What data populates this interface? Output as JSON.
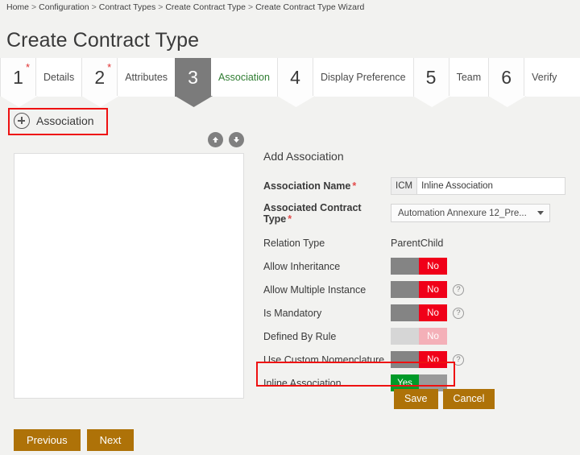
{
  "breadcrumb": {
    "items": [
      "Home",
      "Configuration",
      "Contract Types",
      "Create Contract Type",
      "Create Contract Type Wizard"
    ],
    "separator": ">"
  },
  "page": {
    "title": "Create Contract Type"
  },
  "wizard": {
    "steps": [
      {
        "number": "1",
        "label": "Details",
        "required": "*",
        "active": false
      },
      {
        "number": "2",
        "label": "Attributes",
        "required": "*",
        "active": false
      },
      {
        "number": "3",
        "label": "Association",
        "required": "",
        "active": true
      },
      {
        "number": "4",
        "label": "Display Preference",
        "required": "",
        "active": false
      },
      {
        "number": "5",
        "label": "Team",
        "required": "",
        "active": false
      },
      {
        "number": "6",
        "label": "Verify",
        "required": "",
        "active": false
      }
    ],
    "active_color": "#7b7b7b",
    "active_label_color": "#2f7d32"
  },
  "association_section": {
    "add_label": "Association",
    "add_icon": "plus-circle-icon",
    "move_up_icon": "arrow-up-icon",
    "move_down_icon": "arrow-down-icon",
    "list_items": []
  },
  "form": {
    "title": "Add Association",
    "association_name": {
      "label": "Association Name",
      "required": "*",
      "prefix": "ICM",
      "value": "Inline Association",
      "placeholder": ""
    },
    "associated_contract_type": {
      "label": "Associated Contract Type",
      "required": "*",
      "selected": "Automation Annexure 12_Pre..."
    },
    "relation_type": {
      "label": "Relation Type",
      "value": "ParentChild"
    },
    "toggles": [
      {
        "label": "Allow Inheritance",
        "value": "No",
        "state": "off",
        "help": false,
        "disabled": false,
        "highlighted": false
      },
      {
        "label": "Allow Multiple Instance",
        "value": "No",
        "state": "off",
        "help": true,
        "disabled": false,
        "highlighted": false
      },
      {
        "label": "Is Mandatory",
        "value": "No",
        "state": "off",
        "help": true,
        "disabled": false,
        "highlighted": false
      },
      {
        "label": "Defined By Rule",
        "value": "No",
        "state": "off",
        "help": false,
        "disabled": true,
        "highlighted": false
      },
      {
        "label": "Use Custom Nomenclature",
        "value": "No",
        "state": "off",
        "help": true,
        "disabled": false,
        "highlighted": false
      },
      {
        "label": "Inline Association",
        "value": "Yes",
        "state": "on",
        "help": false,
        "disabled": false,
        "highlighted": true
      }
    ],
    "save_label": "Save",
    "cancel_label": "Cancel"
  },
  "footer": {
    "previous_label": "Previous",
    "next_label": "Next"
  },
  "colors": {
    "toggle_off_red": "#f00019",
    "toggle_on_green": "#009a28",
    "toggle_gray": "#848484",
    "button_gold": "#ae7208",
    "annotation_red": "#ee1111",
    "page_background": "#f2f2f0"
  }
}
